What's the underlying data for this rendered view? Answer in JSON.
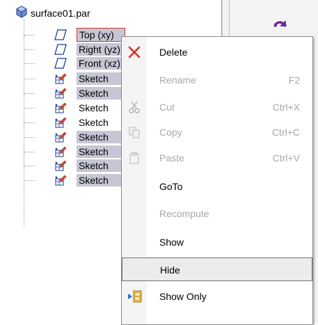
{
  "tree": {
    "root_label": "surface01.par",
    "items": [
      {
        "label": "Top (xy)",
        "icon": "plane-icon"
      },
      {
        "label": "Right (yz)",
        "icon": "plane-icon"
      },
      {
        "label": "Front (xz)",
        "icon": "plane-icon"
      },
      {
        "label": "Sketch",
        "icon": "sketch-icon"
      },
      {
        "label": "Sketch",
        "icon": "sketch-icon"
      },
      {
        "label": "Sketch",
        "icon": "sketch-icon"
      },
      {
        "label": "Sketch",
        "icon": "sketch-icon"
      },
      {
        "label": "Sketch",
        "icon": "sketch-icon"
      },
      {
        "label": "Sketch",
        "icon": "sketch-icon"
      },
      {
        "label": "Sketch",
        "icon": "sketch-icon"
      },
      {
        "label": "Sketch",
        "icon": "sketch-icon"
      }
    ]
  },
  "context_menu": {
    "items": [
      {
        "label": "Delete",
        "shortcut": "",
        "enabled": true,
        "icon": "delete-icon"
      },
      {
        "label": "Rename",
        "shortcut": "F2",
        "enabled": false,
        "icon": ""
      },
      {
        "label": "Cut",
        "shortcut": "Ctrl+X",
        "enabled": false,
        "icon": "cut-icon"
      },
      {
        "label": "Copy",
        "shortcut": "Ctrl+C",
        "enabled": false,
        "icon": "copy-icon"
      },
      {
        "label": "Paste",
        "shortcut": "Ctrl+V",
        "enabled": false,
        "icon": "paste-icon"
      },
      {
        "label": "GoTo",
        "shortcut": "",
        "enabled": true,
        "icon": ""
      },
      {
        "label": "Recompute",
        "shortcut": "",
        "enabled": false,
        "icon": ""
      },
      {
        "label": "Show",
        "shortcut": "",
        "enabled": true,
        "icon": ""
      },
      {
        "label": "Hide",
        "shortcut": "",
        "enabled": true,
        "icon": ""
      },
      {
        "label": "Show Only",
        "shortcut": "",
        "enabled": true,
        "icon": "show-only-icon"
      }
    ]
  },
  "colors": {
    "selection": "#c6c6d4",
    "focus_border": "#d03030",
    "delete_red": "#e03020",
    "disabled_text": "#a8a8a8"
  }
}
